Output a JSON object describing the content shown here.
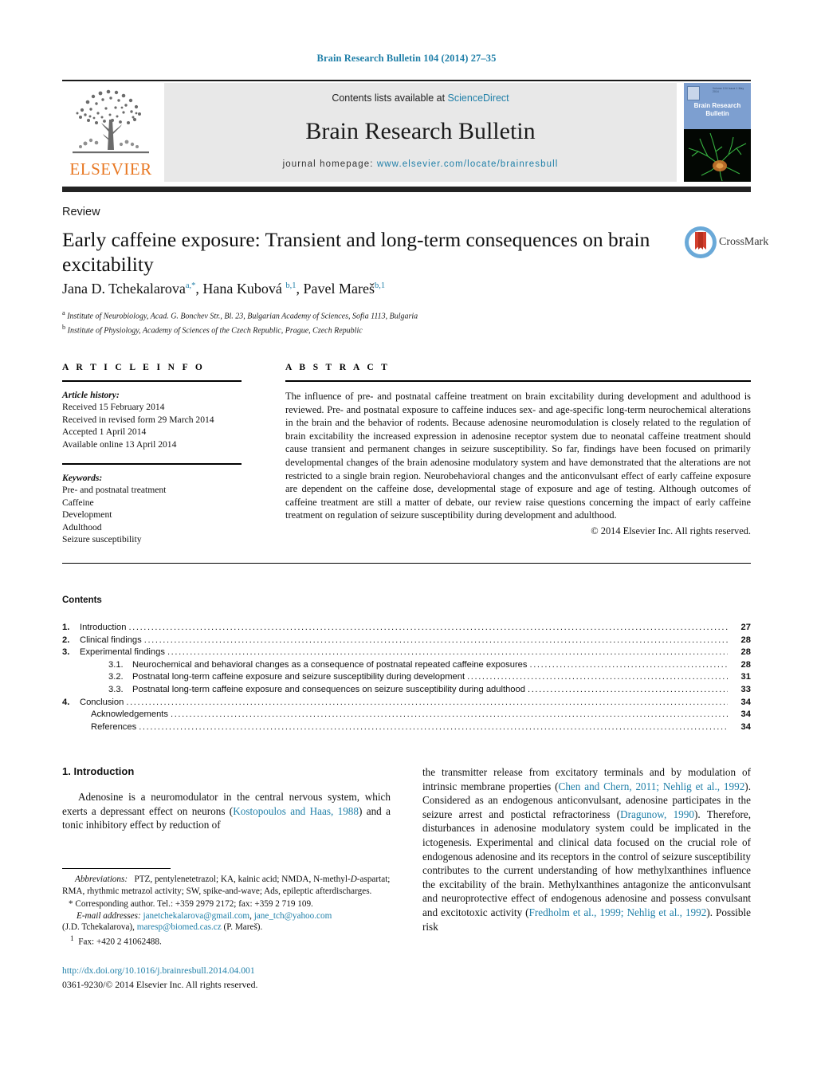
{
  "running_head": "Brain Research Bulletin 104 (2014) 27–35",
  "header": {
    "contents_available": "Contents lists available at ",
    "sciencedirect": "ScienceDirect",
    "journal_name": "Brain Research Bulletin",
    "homepage_label": "journal homepage: ",
    "homepage_url": "www.elsevier.com/locate/brainresbull",
    "publisher_wordmark": "ELSEVIER",
    "cover": {
      "title_line1": "Brain Research",
      "title_line2": "Bulletin",
      "volume_text": "Volume 104  Issue 1  May 2014"
    },
    "accent_color": "#1f7fa8",
    "elsevier_orange": "#e87722"
  },
  "article": {
    "type_label": "Review",
    "title": "Early caffeine exposure: Transient and long-term consequences on brain excitability",
    "authors_html": "Jana D. Tchekalarova<sup>a,*</sup>, Hana Kubová <sup>b,1</sup>, Pavel Mareš<sup>b,1</sup>",
    "affiliation_a": "Institute of Neurobiology, Acad. G. Bonchev Str., Bl. 23, Bulgarian Academy of Sciences, Sofia 1113, Bulgaria",
    "affiliation_b": "Institute of Physiology, Academy of Sciences of the Czech Republic, Prague, Czech Republic",
    "crossmark_label": "CrossMark"
  },
  "article_info": {
    "heading": "A R T I C L E   I N F O",
    "history_label": "Article history:",
    "history": [
      "Received 15 February 2014",
      "Received in revised form 29 March 2014",
      "Accepted 1 April 2014",
      "Available online 13 April 2014"
    ],
    "keywords_label": "Keywords:",
    "keywords": [
      "Pre- and postnatal treatment",
      "Caffeine",
      "Development",
      "Adulthood",
      "Seizure susceptibility"
    ]
  },
  "abstract": {
    "heading": "A B S T R A C T",
    "text": "The influence of pre- and postnatal caffeine treatment on brain excitability during development and adulthood is reviewed. Pre- and postnatal exposure to caffeine induces sex- and age-specific long-term neurochemical alterations in the brain and the behavior of rodents. Because adenosine neuromodulation is closely related to the regulation of brain excitability the increased expression in adenosine receptor system due to neonatal caffeine treatment should cause transient and permanent changes in seizure susceptibility. So far, findings have been focused on primarily developmental changes of the brain adenosine modulatory system and have demonstrated that the alterations are not restricted to a single brain region. Neurobehavioral changes and the anticonvulsant effect of early caffeine exposure are dependent on the caffeine dose, developmental stage of exposure and age of testing. Although outcomes of caffeine treatment are still a matter of debate, our review raise questions concerning the impact of early caffeine treatment on regulation of seizure susceptibility during development and adulthood.",
    "copyright": "© 2014 Elsevier Inc. All rights reserved."
  },
  "contents": {
    "heading": "Contents",
    "entries": [
      {
        "num": "1.",
        "sub": "",
        "label": "Introduction",
        "page": "27"
      },
      {
        "num": "2.",
        "sub": "",
        "label": "Clinical findings",
        "page": "28"
      },
      {
        "num": "3.",
        "sub": "",
        "label": "Experimental findings",
        "page": "28"
      },
      {
        "num": "",
        "sub": "3.1.",
        "label": "Neurochemical and behavioral changes as a consequence of postnatal repeated caffeine exposures",
        "page": "28"
      },
      {
        "num": "",
        "sub": "3.2.",
        "label": "Postnatal long-term caffeine exposure and seizure susceptibility during development",
        "page": "31"
      },
      {
        "num": "",
        "sub": "3.3.",
        "label": "Postnatal long-term caffeine exposure and consequences on seizure susceptibility during adulthood",
        "page": "33"
      },
      {
        "num": "4.",
        "sub": "",
        "label": "Conclusion",
        "page": "34"
      },
      {
        "num": "",
        "sub": "",
        "label": "Acknowledgements",
        "page": "34"
      },
      {
        "num": "",
        "sub": "",
        "label": "References",
        "page": "34"
      }
    ]
  },
  "body": {
    "section_heading": "1.  Introduction",
    "left_paragraph_html": "Adenosine is a neuromodulator in the central nervous system, which exerts a depressant effect on neurons (<span class=\"cite\">Kostopoulos and Haas, 1988</span>) and a tonic inhibitory effect by reduction of",
    "right_paragraph_html": "the transmitter release from excitatory terminals and by modulation of intrinsic membrane properties (<span class=\"cite\">Chen and Chern, 2011; Nehlig et al., 1992</span>). Considered as an endogenous anticonvulsant, adenosine participates in the seizure arrest and postictal refractoriness (<span class=\"cite\">Dragunow, 1990</span>). Therefore, disturbances in adenosine modulatory system could be implicated in the ictogenesis. Experimental and clinical data focused on the crucial role of endogenous adenosine and its receptors in the control of seizure susceptibility contributes to the current understanding of how methylxanthines influence the excitability of the brain. Methylxanthines antagonize the anticonvulsant and neuroprotective effect of endogenous adenosine and possess convulsant and excitotoxic activity (<span class=\"cite\">Fredholm et al., 1999; Nehlig et al., 1992</span>). Possible risk"
  },
  "footnotes": {
    "abbreviations_html": "<span class=\"ital\">Abbreviations:</span>&nbsp;&nbsp; PTZ, pentylenetetrazol; KA, kainic acid; NMDA, N-methyl-<span class=\"ital\">D</span>-aspartat; RMA, rhythmic metrazol activity; SW, spike-and-wave; Ads, epileptic afterdischarges.",
    "corresponding_html": "* Corresponding author. Tel.: +359 2979 2172; fax: +359 2 719 109.",
    "emails_html": "<span class=\"ital\">E-mail addresses:</span> <span class=\"link\">janetchekalarova@gmail.com</span>, <span class=\"link\">jane_tch@yahoo.com</span>",
    "emails_cont_html": "(J.D. Tchekalarova), <span class=\"link\">maresp@biomed.cas.cz</span> (P. Mareš).",
    "fax_html": "<sup>1</sup>&nbsp; Fax: +420 2 41062488.",
    "doi": "http://dx.doi.org/10.1016/j.brainresbull.2014.04.001",
    "issn": "0361-9230/© 2014 Elsevier Inc. All rights reserved."
  }
}
